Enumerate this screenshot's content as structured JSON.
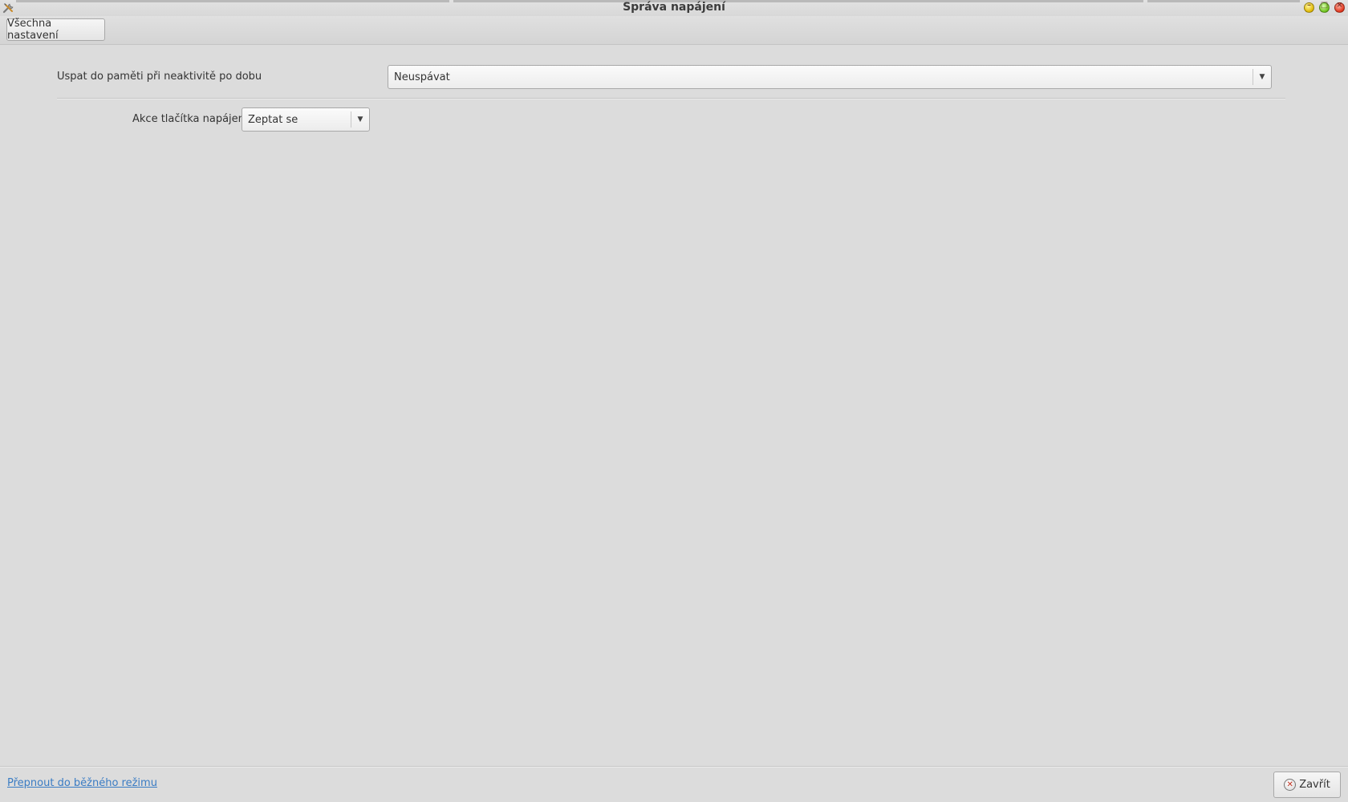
{
  "window": {
    "title": "Správa napájení",
    "icon": "tools-icon"
  },
  "toolbar": {
    "all_settings_label": "Všechna nastavení"
  },
  "settings": {
    "suspend": {
      "label": "Uspat do paměti při neaktivitě po dobu",
      "value": "Neuspávat"
    },
    "power_button": {
      "label": "Akce tlačítka napájení",
      "value": "Zeptat se"
    }
  },
  "footer": {
    "switch_mode_link": "Přepnout do běžného režimu",
    "close_label": "Zavřít"
  },
  "colors": {
    "background": "#dcdcdc",
    "link": "#3a7cc4",
    "close_icon_x": "#c0301e"
  }
}
